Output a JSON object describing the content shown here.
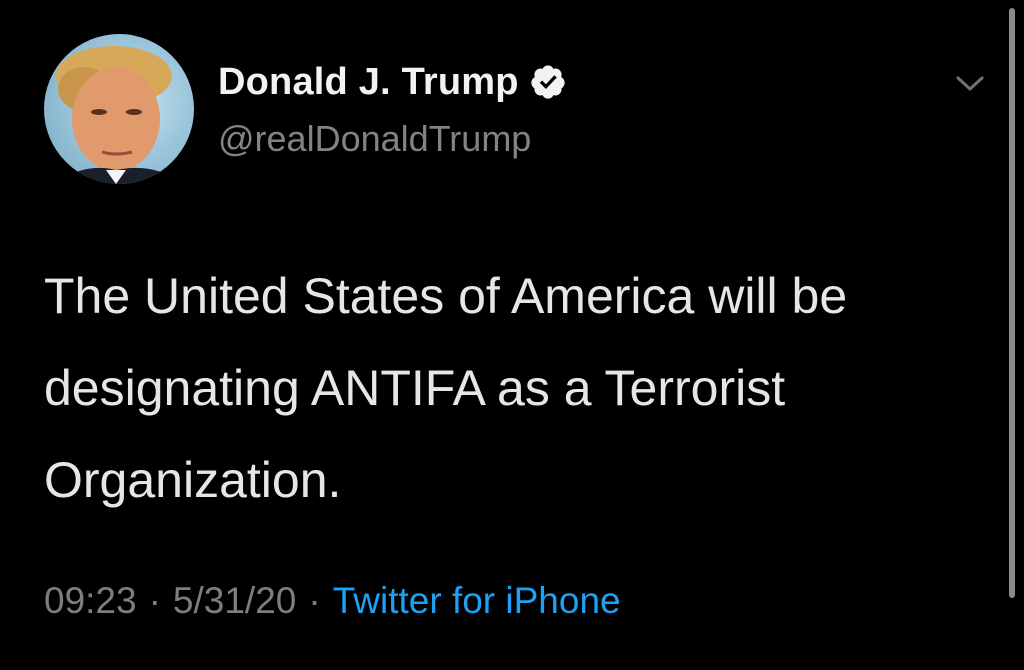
{
  "user": {
    "display_name": "Donald J. Trump",
    "handle": "@realDonaldTrump",
    "verified": true
  },
  "tweet": {
    "text": "The United States of America will be designating ANTIFA as a Terrorist Organization.",
    "time": "09:23",
    "date": "5/31/20",
    "separator": "·",
    "source": "Twitter for iPhone"
  },
  "colors": {
    "background": "#000000",
    "text": "#e6e6e6",
    "muted": "#7a7f84",
    "link": "#1da1f2"
  },
  "icons": {
    "verified": "verified-badge-icon",
    "more": "chevron-down-icon"
  }
}
